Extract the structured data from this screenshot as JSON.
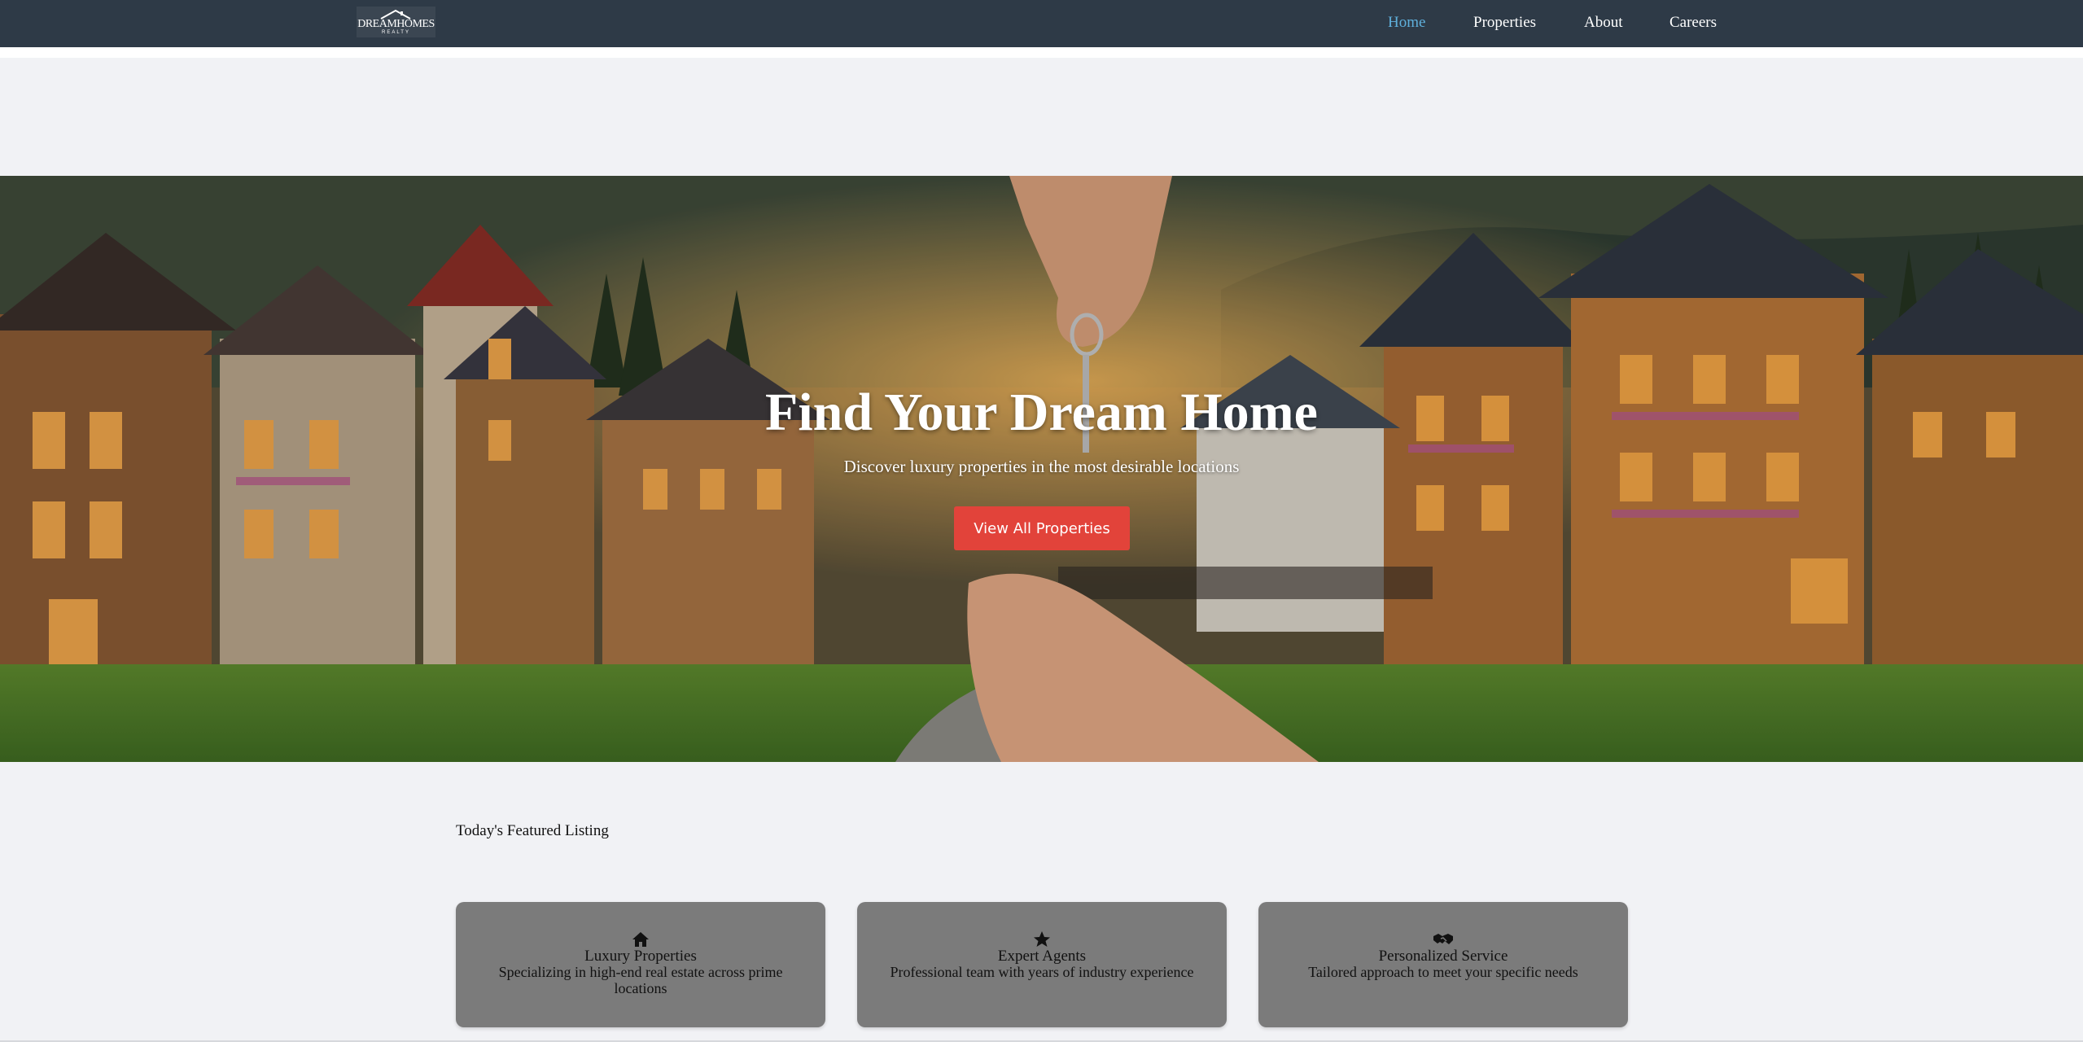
{
  "brand": {
    "logo_main": "DREAMHOMES",
    "logo_sub": "REALTY"
  },
  "nav": {
    "items": [
      {
        "label": "Home",
        "active": true
      },
      {
        "label": "Properties",
        "active": false
      },
      {
        "label": "About",
        "active": false
      },
      {
        "label": "Careers",
        "active": false
      }
    ]
  },
  "hero": {
    "title": "Find Your Dream Home",
    "subtitle": "Discover luxury properties in the most desirable locations",
    "cta_label": "View All Properties"
  },
  "featured": {
    "heading": "Today's Featured Listing",
    "cards": [
      {
        "icon": "home-icon",
        "title": "Luxury Properties",
        "description": "Specializing in high-end real estate across prime locations"
      },
      {
        "icon": "star-icon",
        "title": "Expert Agents",
        "description": "Professional team with years of industry experience"
      },
      {
        "icon": "handshake-icon",
        "title": "Personalized Service",
        "description": "Tailored approach to meet your specific needs"
      }
    ]
  },
  "colors": {
    "navbar": "#2e3a47",
    "nav_active": "#5fb0dc",
    "cta": "#e2433a",
    "card": "#7b7b7b",
    "page_bg": "#f1f2f5"
  }
}
